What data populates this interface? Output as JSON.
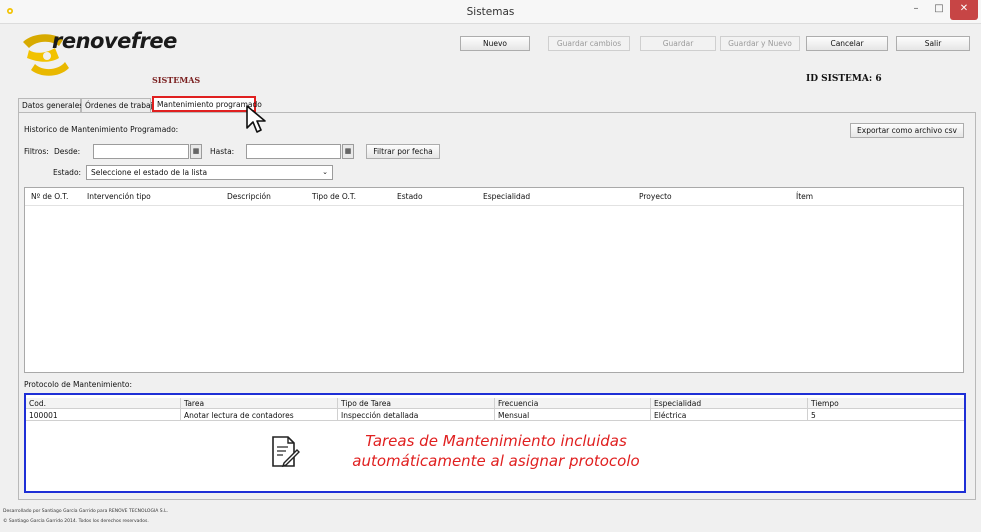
{
  "window": {
    "title": "Sistemas",
    "minimize": "–",
    "maximize": "□",
    "close": "✕"
  },
  "header": {
    "logo_text": "renovefree",
    "section": "SISTEMAS",
    "id_label": "ID SISTEMA:  6"
  },
  "toolbar": {
    "nuevo": "Nuevo",
    "guardar_cambios": "Guardar cambios",
    "guardar": "Guardar",
    "guardar_y_nuevo": "Guardar y Nuevo",
    "cancelar": "Cancelar",
    "salir": "Salir"
  },
  "tabs": [
    {
      "label": "Datos generales"
    },
    {
      "label": "Órdenes de trabajo"
    },
    {
      "label": "Mantenimiento programado"
    }
  ],
  "history": {
    "title": "Historico de Mantenimiento Programado:",
    "export_label": "Exportar como archivo csv",
    "filters_label": "Filtros:",
    "desde_label": "Desde:",
    "hasta_label": "Hasta:",
    "desde_value": "",
    "hasta_value": "",
    "filter_button": "Filtrar por fecha",
    "estado_label": "Estado:",
    "estado_selected": "Seleccione el estado de la lista",
    "columns": [
      "Nº de O.T.",
      "Intervención tipo",
      "Descripción",
      "Tipo de O.T.",
      "Estado",
      "Especialidad",
      "Proyecto",
      "Ítem"
    ]
  },
  "protocol": {
    "title": "Protocolo de Mantenimiento:",
    "columns": [
      "Cod.",
      "Tarea",
      "Tipo de Tarea",
      "Frecuencia",
      "Especialidad",
      "Tiempo"
    ],
    "rows": [
      {
        "cod": "100001",
        "tarea": "Anotar lectura de contadores",
        "tipo": "Inspección detallada",
        "frecuencia": "Mensual",
        "especialidad": "Eléctrica",
        "tiempo": "5"
      }
    ]
  },
  "annotation": {
    "line1": "Tareas de Mantenimiento incluidas",
    "line2": "automáticamente al asignar protocolo"
  },
  "footer": {
    "line1": "Desarrollado por Santiago García Garrido para RENOVE TECNOLOGIA S.L.",
    "line2": "© Santiago García Garrido 2014. Todos los derechos reservados."
  },
  "colors": {
    "highlight_red": "#e02020",
    "highlight_blue": "#1e2fd6",
    "brand_yellow": "#f2c200"
  }
}
